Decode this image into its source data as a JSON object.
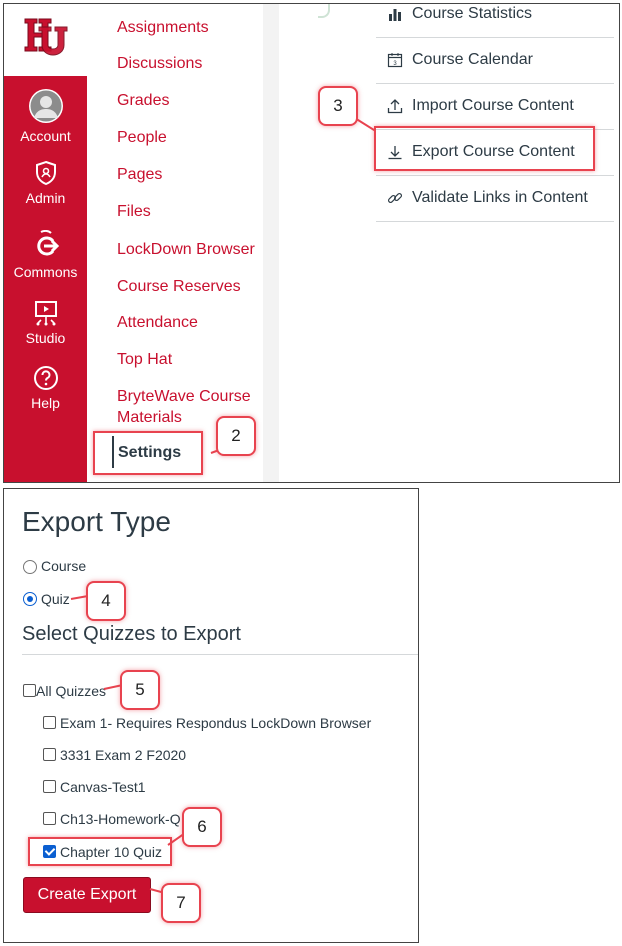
{
  "global_nav": {
    "items": [
      {
        "label": "Account",
        "icon": "avatar-icon"
      },
      {
        "label": "Admin",
        "icon": "shield-icon"
      },
      {
        "label": "Commons",
        "icon": "commons-icon"
      },
      {
        "label": "Studio",
        "icon": "studio-icon"
      },
      {
        "label": "Help",
        "icon": "help-icon"
      }
    ],
    "brand_color": "#c8102e"
  },
  "course_nav": {
    "items": [
      "Assignments",
      "Discussions",
      "Grades",
      "People",
      "Pages",
      "Files",
      "LockDown Browser",
      "Course Reserves",
      "Attendance",
      "Top Hat",
      "BryteWave Course Materials"
    ],
    "active": "Settings"
  },
  "right_menu": {
    "items": [
      {
        "label": "Course Statistics",
        "icon": "bar-chart-icon"
      },
      {
        "label": "Course Calendar",
        "icon": "calendar-icon"
      },
      {
        "label": "Import Course Content",
        "icon": "upload-icon"
      },
      {
        "label": "Export Course Content",
        "icon": "download-icon"
      },
      {
        "label": "Validate Links in Content",
        "icon": "link-icon"
      }
    ]
  },
  "export": {
    "title": "Export Type",
    "types": [
      {
        "label": "Course",
        "selected": false
      },
      {
        "label": "Quiz",
        "selected": true
      }
    ],
    "select_heading": "Select Quizzes to Export",
    "all_label": "All Quizzes",
    "quizzes": [
      {
        "label": "Exam 1- Requires Respondus LockDown Browser",
        "checked": false
      },
      {
        "label": "3331 Exam 2 F2020",
        "checked": false
      },
      {
        "label": "Canvas-Test1",
        "checked": false
      },
      {
        "label": "Ch13-Homework-Q",
        "checked": false
      },
      {
        "label": "Chapter 10 Quiz",
        "checked": true
      }
    ],
    "button": "Create Export"
  },
  "callouts": [
    "2",
    "3",
    "4",
    "5",
    "6",
    "7"
  ]
}
